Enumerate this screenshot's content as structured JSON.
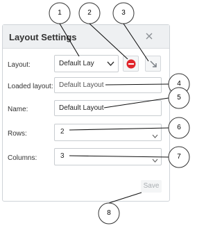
{
  "dialog": {
    "title": "Layout Settings",
    "close_icon": "close-icon",
    "layout_label": "Layout:",
    "layout_value": "Default Lay",
    "delete_icon": "delete-icon",
    "import_icon": "import-arrow-icon",
    "loaded_label": "Loaded layout:",
    "loaded_value": "Default Layout",
    "name_label": "Name:",
    "name_value": "Default Layout",
    "rows_label": "Rows:",
    "rows_value": "2",
    "columns_label": "Columns:",
    "columns_value": "3",
    "save_label": "Save"
  },
  "callouts": [
    "1",
    "2",
    "3",
    "4",
    "5",
    "6",
    "7",
    "8"
  ],
  "colors": {
    "titlebar": "#eef0f2",
    "delete_red": "#e0262c",
    "save_disabled": "#a9adb1"
  }
}
